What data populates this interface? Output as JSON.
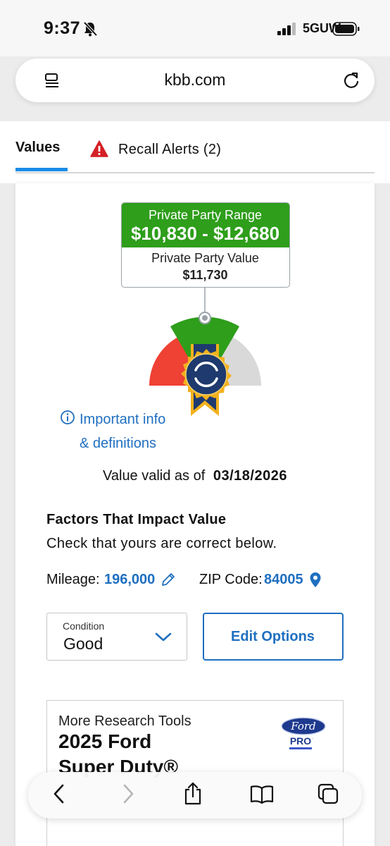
{
  "status_bar": {
    "time": "9:37",
    "network": "5GUW",
    "icons": [
      "bell-slash-icon",
      "signal-icon",
      "battery-icon"
    ]
  },
  "browser": {
    "url": "kbb.com",
    "icons": [
      "reader-icon",
      "reload-icon"
    ]
  },
  "tabs": {
    "values_label": "Values",
    "recall_label": "Recall Alerts (2)",
    "recall_icon": "alert-triangle-icon",
    "active_color": "#1a8be8"
  },
  "valuation": {
    "range_label": "Private Party Range",
    "range_value": "$10,830 - $12,680",
    "value_label": "Private Party Value",
    "value": "$11,730",
    "range_color": "#2e9e1b",
    "gauge_colors": {
      "low": "#ef4134",
      "fair": "#2e9e1b",
      "high": "#d9d9d9",
      "badge": "#1e3a6e",
      "badge_trim": "#f2b11e"
    }
  },
  "info": {
    "line1": "Important info",
    "line2": "& definitions",
    "icon": "info-circle-icon"
  },
  "valid": {
    "label": "Value valid as of",
    "date": "03/18/2026"
  },
  "factors": {
    "title": "Factors That Impact Value",
    "subtitle": "Check that yours are correct below.",
    "mileage_label": "Mileage:",
    "mileage_value": "196,000",
    "zip_label": "ZIP Code:",
    "zip_value": "84005",
    "link_color": "#1f6fc0"
  },
  "condition": {
    "label": "Condition",
    "value": "Good"
  },
  "edit_options_label": "Edit Options",
  "research": {
    "label": "More Research Tools",
    "title_line1": "2025 Ford",
    "title_line2": "Super Duty®",
    "brand_logo": "Ford PRO"
  },
  "toolbar": {
    "icons": [
      "back-icon",
      "forward-icon",
      "share-icon",
      "bookmarks-icon",
      "tabs-icon"
    ]
  }
}
